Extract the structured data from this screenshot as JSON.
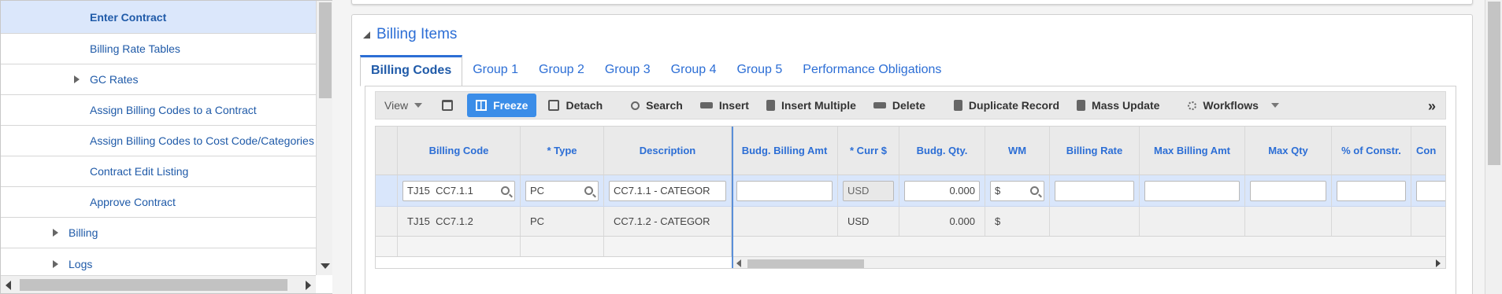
{
  "sidebar": {
    "items": [
      {
        "label": "Enter Contract",
        "active": true,
        "expandable": false
      },
      {
        "label": "Billing Rate Tables",
        "active": false,
        "expandable": false
      },
      {
        "label": "GC Rates",
        "active": false,
        "expandable": true
      },
      {
        "label": "Assign Billing Codes to a Contract",
        "active": false,
        "expandable": false
      },
      {
        "label": "Assign Billing Codes to Cost Code/Categories",
        "active": false,
        "expandable": false
      },
      {
        "label": "Contract Edit Listing",
        "active": false,
        "expandable": false
      },
      {
        "label": "Approve Contract",
        "active": false,
        "expandable": false
      },
      {
        "label": "Billing",
        "active": false,
        "expandable": true
      },
      {
        "label": "Logs",
        "active": false,
        "expandable": true
      }
    ]
  },
  "panel": {
    "title": "Billing Items"
  },
  "tabs": [
    "Billing Codes",
    "Group 1",
    "Group 2",
    "Group 3",
    "Group 4",
    "Group 5",
    "Performance Obligations"
  ],
  "toolbar": {
    "view": "View",
    "freeze": "Freeze",
    "detach": "Detach",
    "search": "Search",
    "insert": "Insert",
    "insert_multiple": "Insert Multiple",
    "delete": "Delete",
    "duplicate": "Duplicate Record",
    "mass_update": "Mass Update",
    "workflows": "Workflows",
    "more": "»"
  },
  "grid": {
    "columns": [
      "Billing Code",
      "* Type",
      "Description",
      "Budg. Billing Amt",
      "* Curr $",
      "Budg. Qty.",
      "WM",
      "Billing Rate",
      "Max Billing Amt",
      "Max Qty",
      "% of Constr.",
      "Con"
    ],
    "edit_row": {
      "billing_code": "TJ15  CC7.1.1",
      "type": "PC",
      "description": "CC7.1.1 - CATEGOR",
      "budg_billing_amt": "",
      "curr": "USD",
      "budg_qty": "0.000",
      "wm": "$",
      "billing_rate": "",
      "max_billing_amt": "",
      "max_qty": "",
      "pct_constr": ""
    },
    "rows": [
      {
        "billing_code": "TJ15  CC7.1.2",
        "type": "PC",
        "description": "CC7.1.2 - CATEGOR",
        "budg_billing_amt": "",
        "curr": "USD",
        "budg_qty": "0.000",
        "wm": "$",
        "billing_rate": "",
        "max_billing_amt": "",
        "max_qty": "",
        "pct_constr": ""
      }
    ]
  },
  "colors": {
    "accent": "#2c6ed5",
    "freeze_button": "#3b8de8",
    "active_row": "#d9e6fb"
  }
}
